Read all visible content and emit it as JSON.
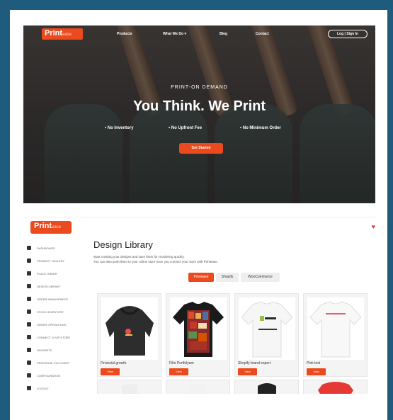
{
  "hero": {
    "logo_main": "Print",
    "logo_sub": "ease",
    "nav": [
      "Products",
      "What We Do ▾",
      "Blog",
      "Contact"
    ],
    "login": "Log | Sign In",
    "eyebrow": "PRINT-ON DEMAND",
    "title": "You Think. We Print",
    "features": [
      "• No Inventory",
      "• No Upfront Fee",
      "• No Minimum Order"
    ],
    "cta": "Get Started"
  },
  "app": {
    "logo_main": "Print",
    "logo_sub": "ease",
    "sidebar": [
      {
        "label": "DASHBOARD",
        "icon": "dashboard-icon"
      },
      {
        "label": "PRODUCT GALLERY",
        "icon": "gallery-icon"
      },
      {
        "label": "PLACE ORDER",
        "icon": "cart-icon"
      },
      {
        "label": "DESIGN LIBRARY",
        "icon": "library-icon"
      },
      {
        "label": "ORDER MANAGEMENT",
        "icon": "orders-icon"
      },
      {
        "label": "STOCK INVENTORY",
        "icon": "inventory-icon"
      },
      {
        "label": "ORDER OPERATIONS",
        "icon": "operations-icon"
      },
      {
        "label": "CONNECT YOUR STORE",
        "icon": "store-icon"
      },
      {
        "label": "PAYMENTS",
        "icon": "payment-icon"
      },
      {
        "label": "PRINTEASE PIN CODES",
        "icon": "pin-icon"
      },
      {
        "label": "CONFIGURATION",
        "icon": "settings-icon"
      },
      {
        "label": "LOGOUT",
        "icon": "logout-icon"
      }
    ],
    "title": "Design Library",
    "desc1": "Start creating your designs and save them for reordering quickly.",
    "desc2": "You can also push them to your online store once you connect your store with Printease.",
    "tabs": [
      "Printease",
      "Shopify",
      "WooCommerce"
    ],
    "products": [
      {
        "name": "Financial growth",
        "button": "View"
      },
      {
        "name": "Film Portfolyam",
        "button": "View"
      },
      {
        "name": "Shopify brand expert",
        "button": "View"
      },
      {
        "name": "Pink test",
        "button": "View"
      }
    ],
    "accent": "#ea4a1d"
  }
}
